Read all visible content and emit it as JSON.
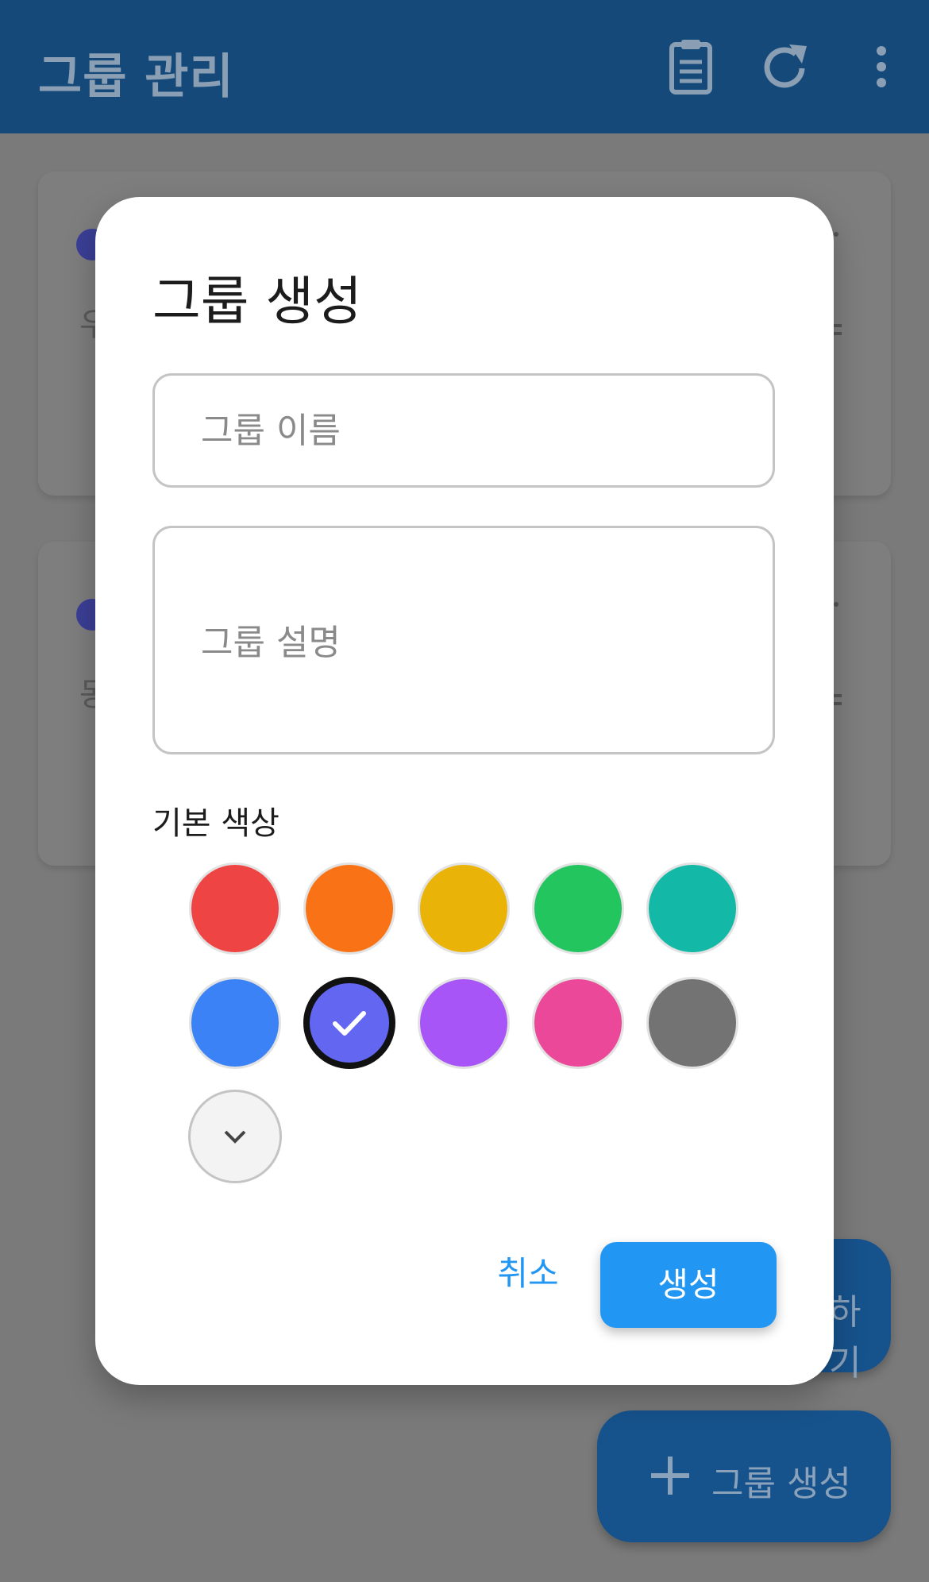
{
  "appbar": {
    "title": "그룹 관리",
    "icons": [
      "clipboard-icon",
      "refresh-icon",
      "more-vert-icon"
    ]
  },
  "background_cards": [
    {
      "text": "우"
    },
    {
      "text": "동"
    }
  ],
  "fabs": {
    "secondary_label": "하기",
    "primary_label": "그룹 생성",
    "primary_icon": "plus-icon"
  },
  "dialog": {
    "title": "그룹 생성",
    "name_placeholder": "그룹 이름",
    "description_placeholder": "그룹 설명",
    "color_label": "기본 색상",
    "colors": [
      "#ef4444",
      "#f97316",
      "#eab308",
      "#22c55e",
      "#14b8a6",
      "#3b82f6",
      "#6366f1",
      "#a855f7",
      "#ec4899",
      "#737373"
    ],
    "selected_color": "#6366f1",
    "expand_icon": "chevron-down-icon",
    "cancel_label": "취소",
    "create_label": "생성"
  }
}
